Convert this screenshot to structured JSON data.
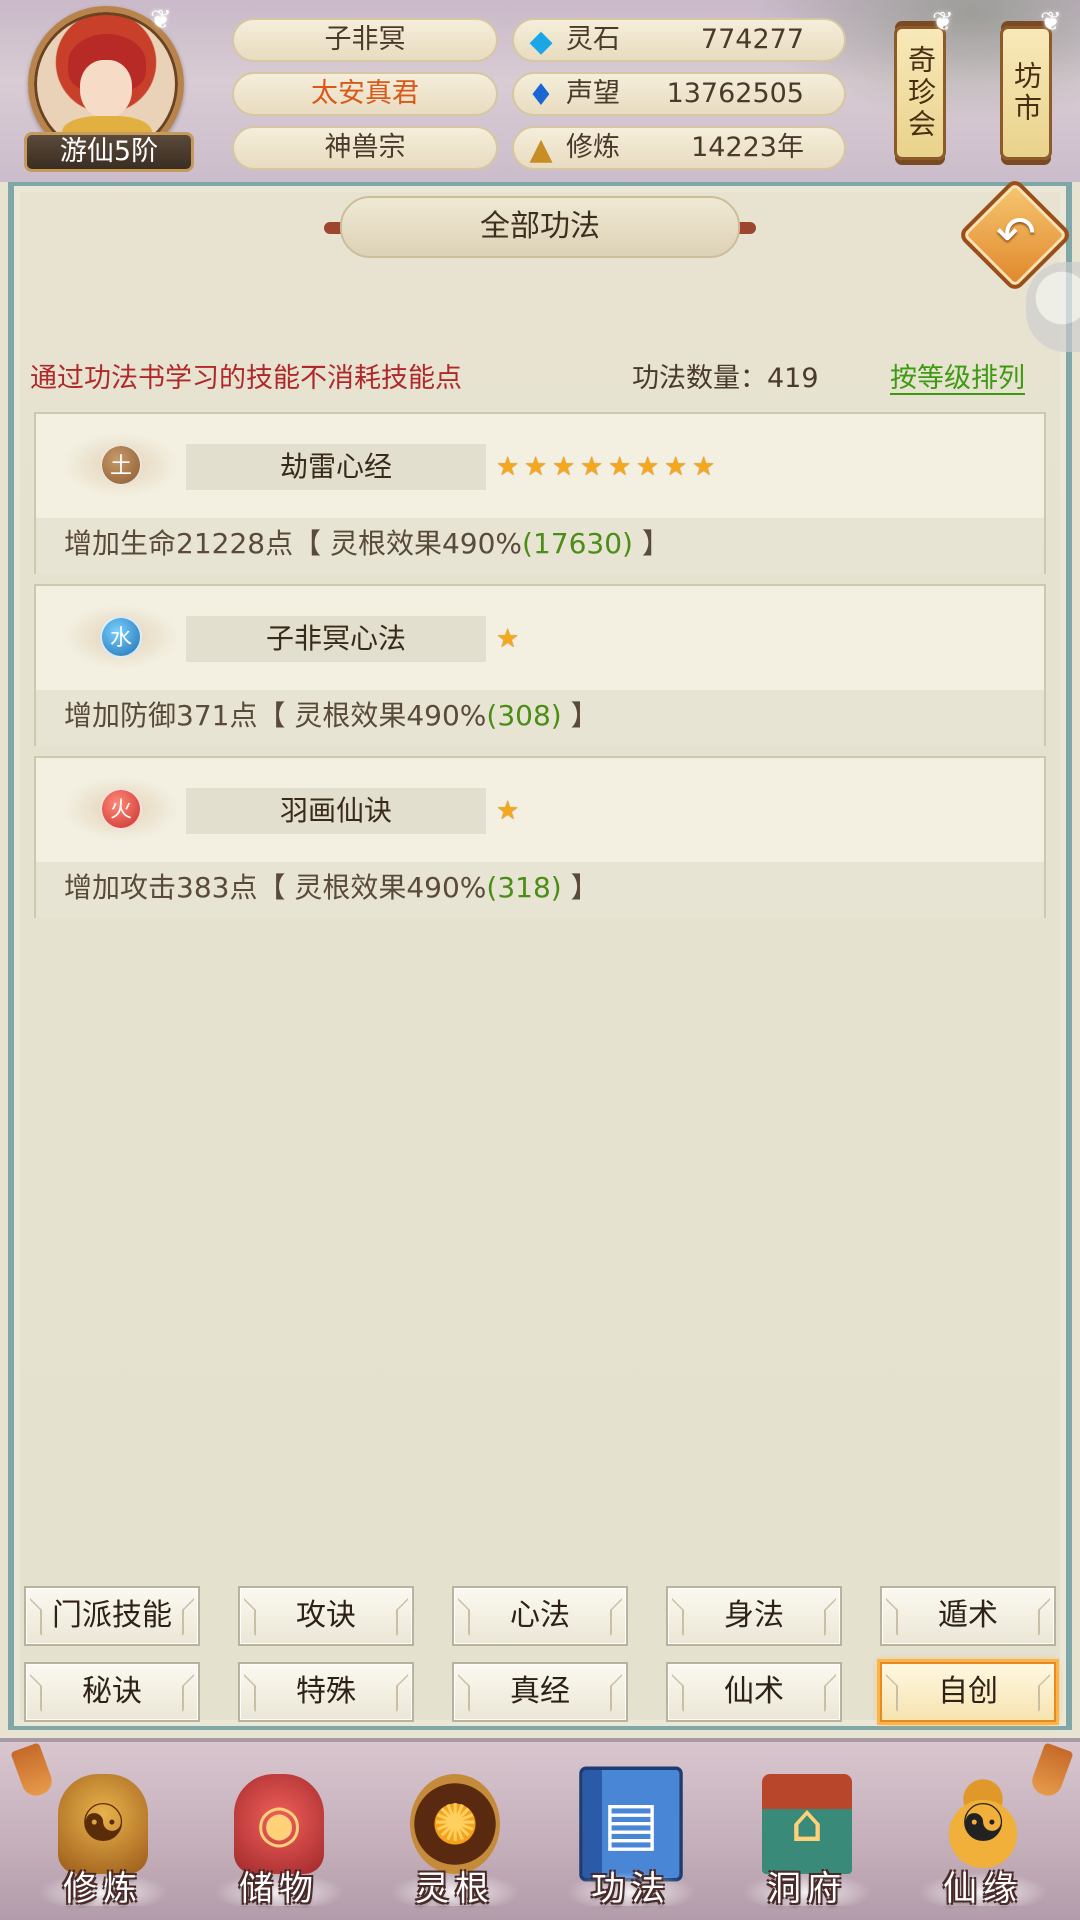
{
  "header": {
    "rank": "游仙5阶",
    "player_name": "子非冥",
    "player_title": "太安真君",
    "sect": "神兽宗",
    "resources": [
      {
        "icon": "spirit-stone-icon",
        "label": "灵石",
        "value": "774277"
      },
      {
        "icon": "prestige-icon",
        "label": "声望",
        "value": "13762505"
      },
      {
        "icon": "cultivation-icon",
        "label": "修炼",
        "value": "14223年"
      }
    ],
    "shortcuts": [
      "奇珍会",
      "坊市"
    ]
  },
  "panel": {
    "title": "全部功法",
    "notice": "通过功法书学习的技能不消耗技能点",
    "count_label": "功法数量：419",
    "sort_label": "按等级排列"
  },
  "skills": [
    {
      "element": "土",
      "element_type": "earth",
      "name": "劫雷心经",
      "stars": 8,
      "effect_prefix": "增加生命21228点【 灵根效果490%",
      "effect_bonus": "(17630)",
      "effect_suffix": " 】"
    },
    {
      "element": "水",
      "element_type": "water",
      "name": "子非冥心法",
      "stars": 1,
      "effect_prefix": "增加防御371点【 灵根效果490%",
      "effect_bonus": "(308)",
      "effect_suffix": " 】"
    },
    {
      "element": "火",
      "element_type": "fire",
      "name": "羽画仙诀",
      "stars": 1,
      "effect_prefix": "增加攻击383点【 灵根效果490%",
      "effect_bonus": "(318)",
      "effect_suffix": " 】"
    }
  ],
  "categories": [
    {
      "label": "门派技能",
      "active": false
    },
    {
      "label": "攻诀",
      "active": false
    },
    {
      "label": "心法",
      "active": false
    },
    {
      "label": "身法",
      "active": false
    },
    {
      "label": "遁术",
      "active": false
    },
    {
      "label": "秘诀",
      "active": false
    },
    {
      "label": "特殊",
      "active": false
    },
    {
      "label": "真经",
      "active": false
    },
    {
      "label": "仙术",
      "active": false
    },
    {
      "label": "自创",
      "active": true
    }
  ],
  "bottom_nav": [
    {
      "label": "修炼",
      "icon": "meditating-figure-icon",
      "active": false
    },
    {
      "label": "储物",
      "icon": "storage-bag-icon",
      "active": false
    },
    {
      "label": "灵根",
      "icon": "spirit-root-icon",
      "active": false
    },
    {
      "label": "功法",
      "icon": "skill-book-icon",
      "active": true
    },
    {
      "label": "洞府",
      "icon": "cave-mansion-icon",
      "active": false
    },
    {
      "label": "仙缘",
      "icon": "gourd-icon",
      "active": false
    }
  ],
  "colors": {
    "notice": "#b0292a",
    "sort_link": "#3e9a12",
    "bonus": "#4b8d16",
    "title_text": "#d85a1a",
    "star": "#f4a81e",
    "active_tab_border": "#e88a20"
  }
}
